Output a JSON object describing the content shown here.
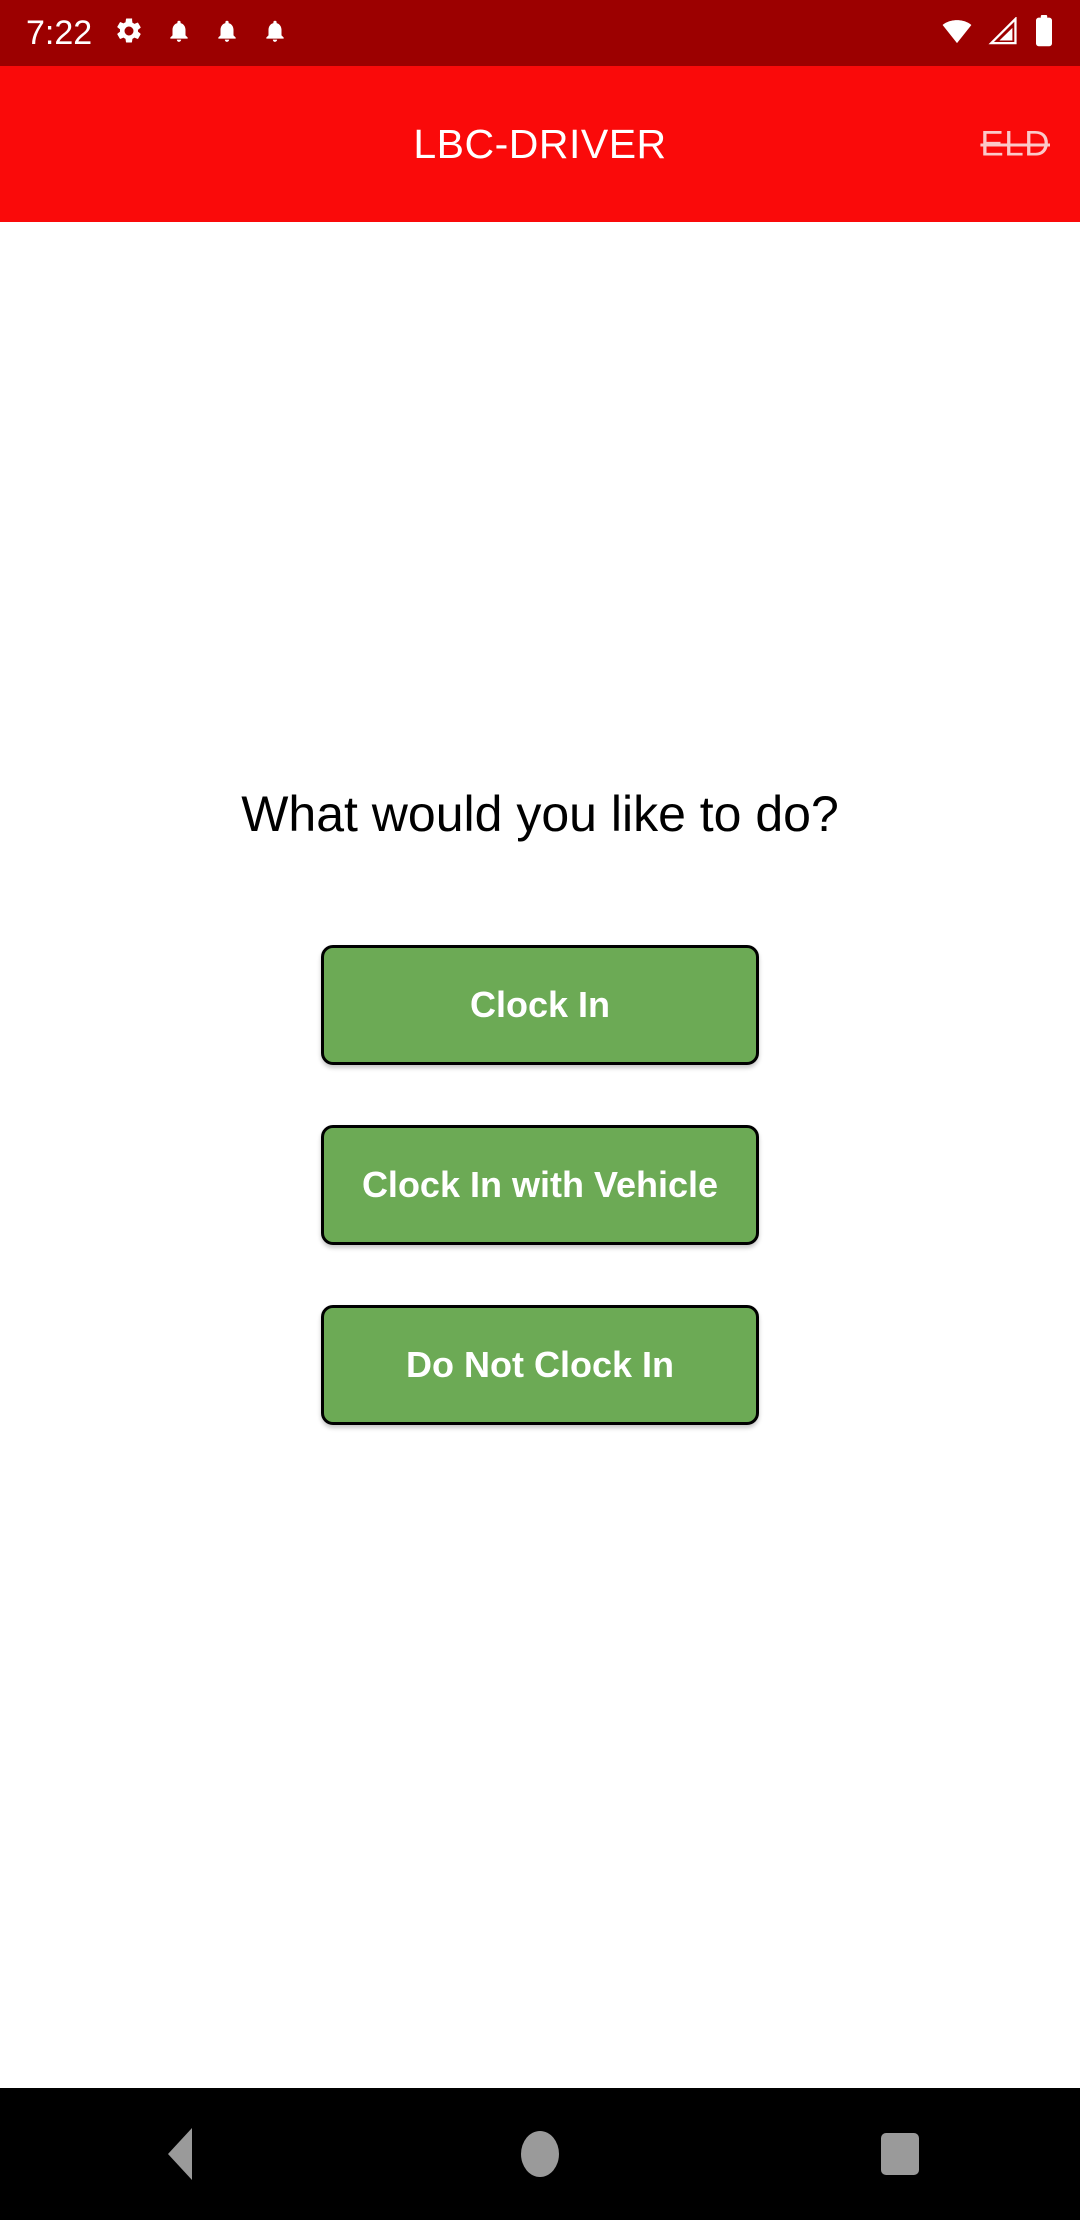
{
  "status_bar": {
    "time": "7:22",
    "left_icons": [
      "settings-gear-icon",
      "notification-bell-icon",
      "notification-bell-icon",
      "notification-bell-icon"
    ],
    "right_icons": [
      "wifi-icon",
      "cellular-signal-icon",
      "battery-icon"
    ],
    "background_color": "#9C0000"
  },
  "app_bar": {
    "title": "LBC-DRIVER",
    "action_label": "ELD",
    "background_color": "#FA0A0A",
    "title_color": "#FFFFFF",
    "action_color": "#FBC9C9"
  },
  "main": {
    "prompt": "What would you like to do?",
    "buttons": [
      {
        "label": "Clock In"
      },
      {
        "label": "Clock In with Vehicle"
      },
      {
        "label": "Do Not Clock In"
      }
    ],
    "button_color": "#6CAA55",
    "button_text_color": "#FFFFFF",
    "button_border_color": "#000000",
    "background_color": "#FFFFFF"
  },
  "nav_bar": {
    "background_color": "#000000",
    "icon_color": "#9A9A9A",
    "items": [
      {
        "icon": "back-triangle-icon"
      },
      {
        "icon": "home-circle-icon"
      },
      {
        "icon": "recents-square-icon"
      }
    ]
  }
}
